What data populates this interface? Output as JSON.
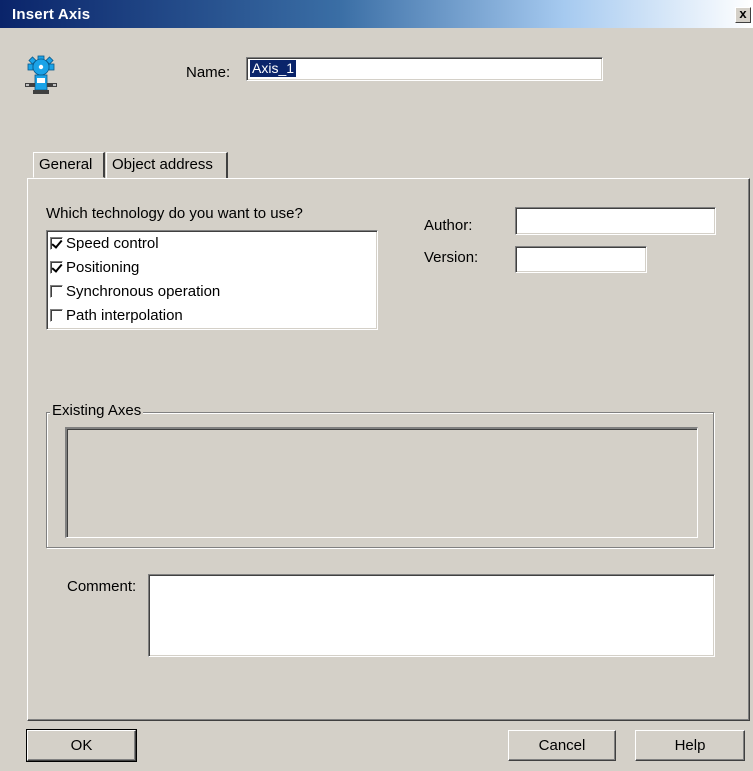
{
  "window": {
    "title": "Insert Axis",
    "close_label": "x"
  },
  "header": {
    "icon": "axis-motor-icon",
    "name_label": "Name:",
    "name_value": "Axis_1"
  },
  "tabs": [
    {
      "label": "General",
      "active": true
    },
    {
      "label": "Object address",
      "active": false
    }
  ],
  "general": {
    "technology_question": "Which technology do you want to use?",
    "technologies": [
      {
        "label": "Speed control",
        "checked": true
      },
      {
        "label": "Positioning",
        "checked": true
      },
      {
        "label": "Synchronous operation",
        "checked": false
      },
      {
        "label": "Path interpolation",
        "checked": false
      }
    ],
    "author_label": "Author:",
    "author_value": "",
    "version_label": "Version:",
    "version_value": "",
    "existing_axes_label": "Existing Axes",
    "existing_axes": [],
    "comment_label": "Comment:",
    "comment_value": ""
  },
  "buttons": {
    "ok": "OK",
    "cancel": "Cancel",
    "help": "Help"
  },
  "colors": {
    "dialog_face": "#d4d0c8",
    "title_start": "#0a246a",
    "title_end": "#ffffff",
    "selection": "#0a246a",
    "icon_body": "#1aa3e8"
  }
}
